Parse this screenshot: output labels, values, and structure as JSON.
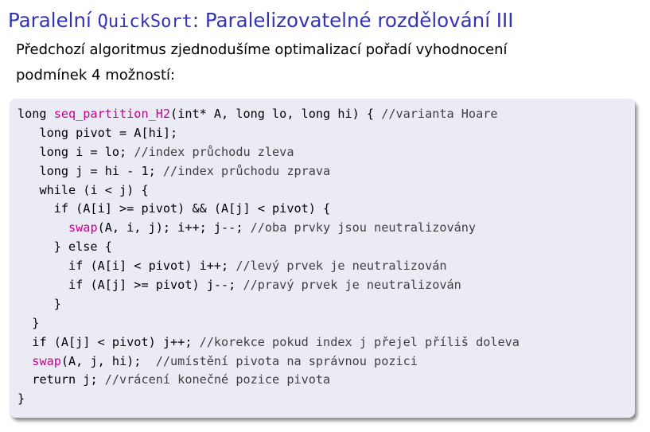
{
  "slide": {
    "title_prefix": "Paralelní ",
    "title_mono": "QuickSort",
    "title_suffix": ": Paralelizovatelné rozdělování III",
    "intro_line1": "Předchozí algoritmus zjednodušíme optimalizací pořadí vyhodnocení",
    "intro_line2": "podmínek 4 možností:"
  },
  "code": {
    "lines": [
      {
        "indent": "",
        "pre": "long ",
        "fn": "seq_partition_H2",
        "post": "(int* A, long lo, long hi) { ",
        "comment": "//varianta Hoare"
      },
      {
        "indent": "   ",
        "pre": "long pivot = A[hi];",
        "fn": "",
        "post": "",
        "comment": ""
      },
      {
        "indent": "   ",
        "pre": "long i = lo; ",
        "fn": "",
        "post": "",
        "comment": "//index průchodu zleva"
      },
      {
        "indent": "   ",
        "pre": "long j = hi - 1; ",
        "fn": "",
        "post": "",
        "comment": "//index průchodu zprava"
      },
      {
        "indent": "   ",
        "pre": "while (i < j) {",
        "fn": "",
        "post": "",
        "comment": ""
      },
      {
        "indent": "     ",
        "pre": "if (A[i] >= pivot) && (A[j] < pivot) {",
        "fn": "",
        "post": "",
        "comment": ""
      },
      {
        "indent": "       ",
        "pre": "",
        "fn": "swap",
        "post": "(A, i, j); i++; j--; ",
        "comment": "//oba prvky jsou neutralizovány"
      },
      {
        "indent": "     ",
        "pre": "} else {",
        "fn": "",
        "post": "",
        "comment": ""
      },
      {
        "indent": "       ",
        "pre": "if (A[i] < pivot) i++; ",
        "fn": "",
        "post": "",
        "comment": "//levý prvek je neutralizován"
      },
      {
        "indent": "       ",
        "pre": "if (A[j] >= pivot) j--; ",
        "fn": "",
        "post": "",
        "comment": "//pravý prvek je neutralizován"
      },
      {
        "indent": "     ",
        "pre": "}",
        "fn": "",
        "post": "",
        "comment": ""
      },
      {
        "indent": "  ",
        "pre": "}",
        "fn": "",
        "post": "",
        "comment": ""
      },
      {
        "indent": "  ",
        "pre": "if (A[j] < pivot) j++; ",
        "fn": "",
        "post": "",
        "comment": "//korekce pokud index j přejel příliš doleva"
      },
      {
        "indent": "  ",
        "pre": "",
        "fn": "swap",
        "post": "(A, j, hi);  ",
        "comment": "//umístění pivota na správnou pozici"
      },
      {
        "indent": "  ",
        "pre": "return j; ",
        "fn": "",
        "post": "",
        "comment": "//vrácení konečné pozice pivota"
      },
      {
        "indent": "",
        "pre": "}",
        "fn": "",
        "post": "",
        "comment": ""
      }
    ]
  },
  "colors": {
    "title": "#3333b3",
    "function_name": "#c8008c",
    "code_background": "#ebebf5"
  }
}
